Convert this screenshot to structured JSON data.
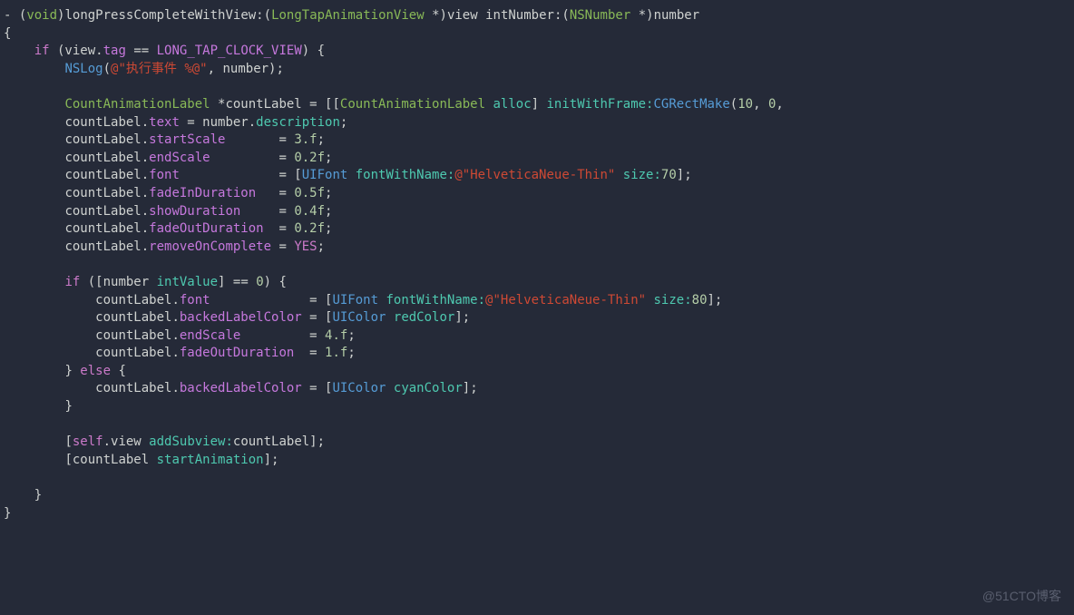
{
  "watermark": "@51CTO博客",
  "code": {
    "sig": {
      "dash": "-",
      "lparen": "(",
      "void": "void",
      "rparen": ")",
      "m1": "longPressCompleteWithView:",
      "p1t": "LongTapAnimationView",
      "p1s": " *)",
      "p1n": "view ",
      "m2": "intNumber:",
      "p2t": "NSNumber",
      "p2s": " *)",
      "p2n": "number"
    },
    "open": "{",
    "close": "}",
    "ifClauseKw": "if",
    "ifCond": {
      "a": " (view.",
      "tag": "tag",
      "eq": " == ",
      "val": "LONG_TAP_CLOCK_VIEW",
      "end": ") {"
    },
    "nslog": {
      "fn": "NSLog",
      "open": "(",
      "at": "@",
      "str": "\"执行事件 %@\"",
      "rest": ", number);"
    },
    "declA": "CountAnimationLabel",
    "declB": " *countLabel = [[",
    "declC": "CountAnimationLabel",
    "declD": " alloc",
    "declE": "] ",
    "declF": "initWithFrame:",
    "declG": "CGRectMake",
    "declH": "(",
    "num10": "10",
    "sepc": ", ",
    "num0": "0",
    "declI": ",",
    "line_text": {
      "lhs": "countLabel.",
      "prop": "text",
      "mid": " = number.",
      "rhs": "description",
      "end": ";"
    },
    "line_startScale": {
      "lhs": "countLabel.",
      "prop": "startScale",
      "pad": "       = ",
      "val": "3.f",
      "end": ";"
    },
    "line_endScale": {
      "lhs": "countLabel.",
      "prop": "endScale",
      "pad": "         = ",
      "val": "0.2f",
      "end": ";"
    },
    "line_font": {
      "lhs": "countLabel.",
      "prop": "font",
      "pad": "             = [",
      "uifont": "UIFont",
      "sel": " fontWithName:",
      "at": "@",
      "str": "\"HelveticaNeue-Thin\"",
      "sel2": " size:",
      "sz": "70",
      "end": "];"
    },
    "line_fadeIn": {
      "lhs": "countLabel.",
      "prop": "fadeInDuration",
      "pad": "   = ",
      "val": "0.5f",
      "end": ";"
    },
    "line_showDur": {
      "lhs": "countLabel.",
      "prop": "showDuration",
      "pad": "     = ",
      "val": "0.4f",
      "end": ";"
    },
    "line_fadeOut": {
      "lhs": "countLabel.",
      "prop": "fadeOutDuration",
      "pad": "  = ",
      "val": "0.2f",
      "end": ";"
    },
    "line_remove": {
      "lhs": "countLabel.",
      "prop": "removeOnComplete",
      "pad": " = ",
      "val": "YES",
      "end": ";"
    },
    "inner_if_kw": "if",
    "inner_if": " ([number ",
    "inner_if_sel": "intValue",
    "inner_if_end": "] == ",
    "inner_if_zero": "0",
    "inner_if_close": ") {",
    "line2_font": {
      "lhs": "countLabel.",
      "prop": "font",
      "pad": "             = [",
      "uifont": "UIFont",
      "sel": " fontWithName:",
      "at": "@",
      "str": "\"HelveticaNeue-Thin\"",
      "sel2": " size:",
      "sz": "80",
      "end": "];"
    },
    "line2_backed": {
      "lhs": "countLabel.",
      "prop": "backedLabelColor",
      "pad": " = [",
      "cls": "UIColor",
      "sel": " redColor",
      "end": "];"
    },
    "line2_endScale": {
      "lhs": "countLabel.",
      "prop": "endScale",
      "pad": "         = ",
      "val": "4.f",
      "end": ";"
    },
    "line2_fadeOut": {
      "lhs": "countLabel.",
      "prop": "fadeOutDuration",
      "pad": "  = ",
      "val": "1.f",
      "end": ";"
    },
    "else_open": "} ",
    "else_kw": "else",
    "else_close": " {",
    "line3_backed": {
      "lhs": "countLabel.",
      "prop": "backedLabelColor",
      "pad": " = [",
      "cls": "UIColor",
      "sel": " cyanColor",
      "end": "];"
    },
    "brace_close": "}",
    "add1a": "[",
    "add1b": "self",
    "add1c": ".view ",
    "add1d": "addSubview:",
    "add1e": "countLabel];",
    "add2a": "[countLabel ",
    "add2b": "startAnimation",
    "add2c": "];"
  }
}
